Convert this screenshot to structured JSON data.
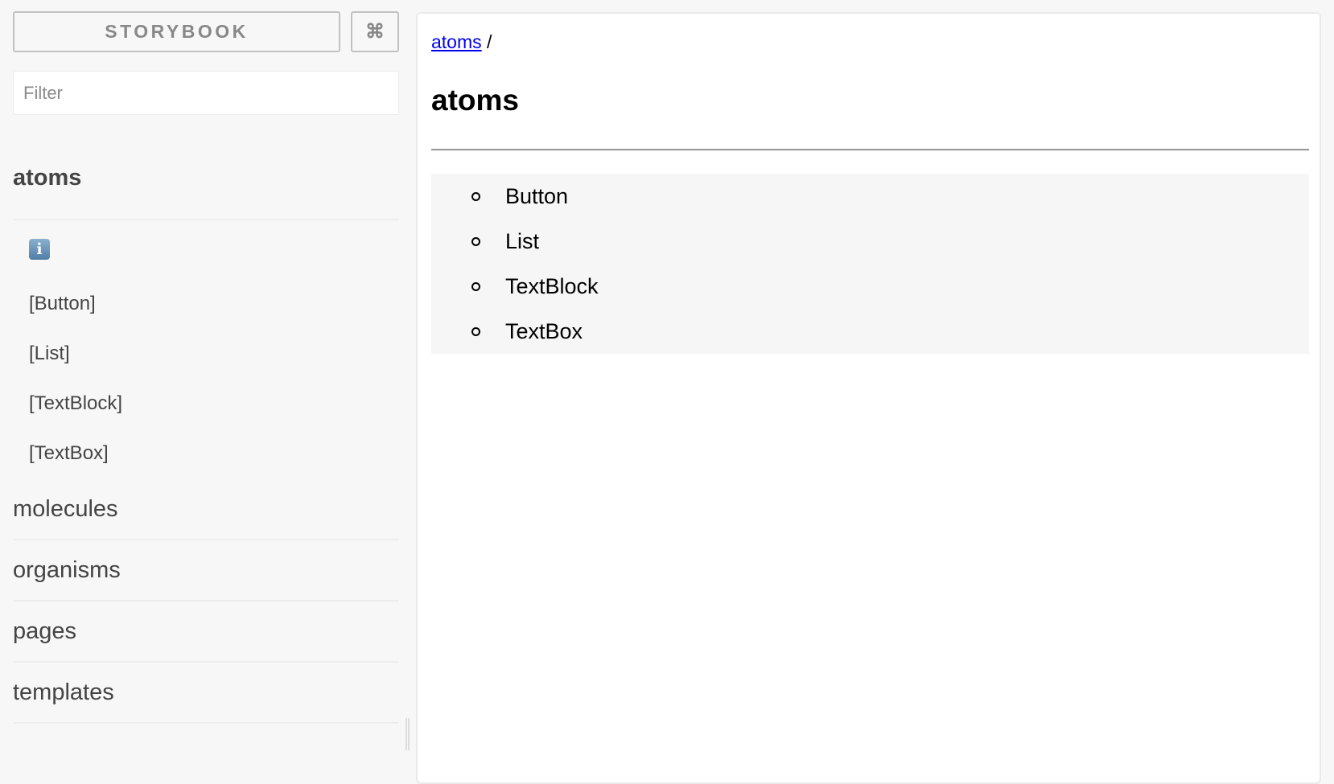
{
  "sidebar": {
    "brand": "STORYBOOK",
    "shortcuts_icon": "⌘",
    "filter_placeholder": "Filter",
    "kinds": [
      {
        "label": "atoms",
        "stories": [
          "[Button]",
          "[List]",
          "[TextBlock]",
          "[TextBox]"
        ]
      },
      {
        "label": "molecules"
      },
      {
        "label": "organisms"
      },
      {
        "label": "pages"
      },
      {
        "label": "templates"
      }
    ],
    "info_icon": "i"
  },
  "main": {
    "breadcrumb": {
      "link": "atoms",
      "separator": "/"
    },
    "title": "atoms",
    "items": [
      "Button",
      "List",
      "TextBlock",
      "TextBox"
    ]
  },
  "colors": {
    "link": "#0000ee",
    "sidebar_bg": "#f7f7f7"
  }
}
